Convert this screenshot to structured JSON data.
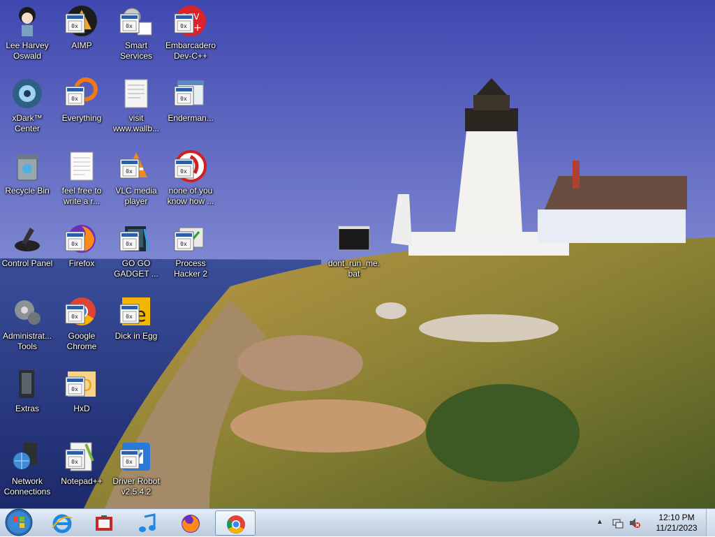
{
  "desktop": {
    "icons": [
      {
        "label": "Lee Harvey Oswald",
        "icon": "anime-character-icon"
      },
      {
        "label": "AIMP",
        "icon": "aimp-icon"
      },
      {
        "label": "Smart Services",
        "icon": "gears-icon"
      },
      {
        "label": "Embarcadero Dev-C++",
        "icon": "devcpp-icon"
      },
      {
        "label": "xDark™ Center",
        "icon": "xdark-icon"
      },
      {
        "label": "Everything",
        "icon": "everything-icon"
      },
      {
        "label": "visit www.wallb...",
        "icon": "document-icon"
      },
      {
        "label": "Enderman...",
        "icon": "app-window-icon"
      },
      {
        "label": "Recycle Bin",
        "icon": "recycle-bin-icon"
      },
      {
        "label": "feel free to write a r...",
        "icon": "text-file-icon"
      },
      {
        "label": "VLC media player",
        "icon": "vlc-icon"
      },
      {
        "label": "none of you know how ...",
        "icon": "red-circle-app-icon"
      },
      {
        "label": "Control Panel",
        "icon": "control-panel-icon"
      },
      {
        "label": "Firefox",
        "icon": "firefox-icon"
      },
      {
        "label": "GO GO GADGET ...",
        "icon": "gadget-icon"
      },
      {
        "label": "Process Hacker 2",
        "icon": "process-hacker-icon"
      },
      {
        "label": "dont_run_me.bat",
        "icon": "batch-file-icon"
      },
      {
        "label": "Administrat... Tools",
        "icon": "admin-tools-icon"
      },
      {
        "label": "Google Chrome",
        "icon": "chrome-icon"
      },
      {
        "label": "Dick in Egg",
        "icon": "e-app-icon"
      },
      {
        "label": "Extras",
        "icon": "extras-folder-icon"
      },
      {
        "label": "HxD",
        "icon": "hxd-icon"
      },
      {
        "label": "Network Connections",
        "icon": "network-icon"
      },
      {
        "label": "Notepad++",
        "icon": "notepadpp-icon"
      },
      {
        "label": "Driver Robot v2.5.4.2",
        "icon": "driver-robot-icon"
      }
    ]
  },
  "taskbar": {
    "pinned": [
      {
        "name": "internet-explorer",
        "icon": "ie-icon"
      },
      {
        "name": "media-center",
        "icon": "media-icon"
      },
      {
        "name": "itunes",
        "icon": "music-note-icon"
      },
      {
        "name": "firefox",
        "icon": "firefox-icon"
      },
      {
        "name": "chrome",
        "icon": "chrome-icon",
        "active": true
      }
    ],
    "clock": {
      "time": "12:10 PM",
      "date": "11/21/2023"
    }
  },
  "colors": {
    "sky_top": "#4a55b5",
    "sky_bottom": "#b8a0c8",
    "sea": "#2a3e8a",
    "grass": "#9c8a3a",
    "taskbar": "#cfdceb"
  }
}
